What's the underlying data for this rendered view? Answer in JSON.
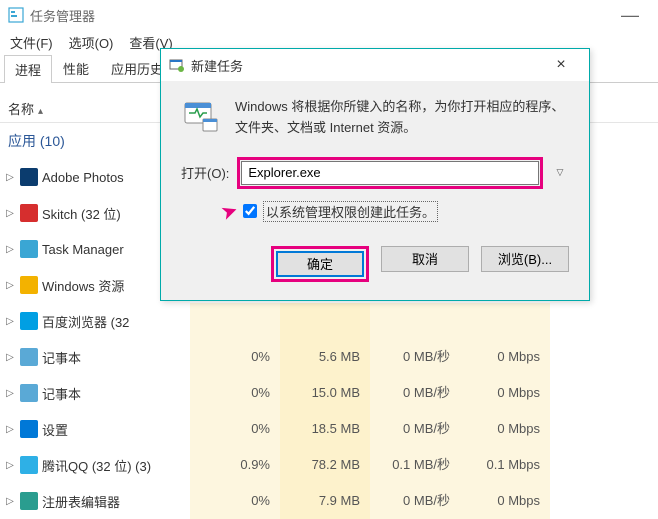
{
  "window": {
    "title": "任务管理器",
    "minimize": "—"
  },
  "menu": {
    "file": "文件(F)",
    "options": "选项(O)",
    "view": "查看(V)"
  },
  "tabs": {
    "processes": "进程",
    "performance": "性能",
    "app_history": "应用历史记"
  },
  "columns": {
    "name": "名称"
  },
  "group": {
    "apps": "应用 (10)"
  },
  "processes": [
    {
      "name": "Adobe Photos",
      "icon_bg": "#0b3c6e"
    },
    {
      "name": "Skitch (32 位)",
      "icon_bg": "#d62e2e"
    },
    {
      "name": "Task Manager",
      "icon_bg": "#3aa6d4"
    },
    {
      "name": "Windows 资源",
      "icon_bg": "#f3b200"
    },
    {
      "name": "百度浏览器 (32",
      "icon_bg": "#009fe3",
      "cpu": "",
      "mem": "",
      "disk": "",
      "net": ""
    },
    {
      "name": "记事本",
      "icon_bg": "#5aa9d6",
      "cpu": "0%",
      "mem": "5.6 MB",
      "disk": "0 MB/秒",
      "net": "0 Mbps"
    },
    {
      "name": "记事本",
      "icon_bg": "#5aa9d6",
      "cpu": "0%",
      "mem": "15.0 MB",
      "disk": "0 MB/秒",
      "net": "0 Mbps"
    },
    {
      "name": "设置",
      "icon_bg": "#0078d7",
      "cpu": "0%",
      "mem": "18.5 MB",
      "disk": "0 MB/秒",
      "net": "0 Mbps"
    },
    {
      "name": "腾讯QQ (32 位) (3)",
      "icon_bg": "#2eb0e6",
      "cpu": "0.9%",
      "mem": "78.2 MB",
      "disk": "0.1 MB/秒",
      "net": "0.1 Mbps"
    },
    {
      "name": "注册表编辑器",
      "icon_bg": "#2a9d8f",
      "cpu": "0%",
      "mem": "7.9 MB",
      "disk": "0 MB/秒",
      "net": "0 Mbps"
    }
  ],
  "dialog": {
    "title": "新建任务",
    "close": "×",
    "description": "Windows 将根据你所键入的名称，为你打开相应的程序、文件夹、文档或 Internet 资源。",
    "open_label": "打开(O):",
    "input_value": "Explorer.exe",
    "checkbox_label": "以系统管理权限创建此任务。",
    "ok": "确定",
    "cancel": "取消",
    "browse": "浏览(B)..."
  }
}
